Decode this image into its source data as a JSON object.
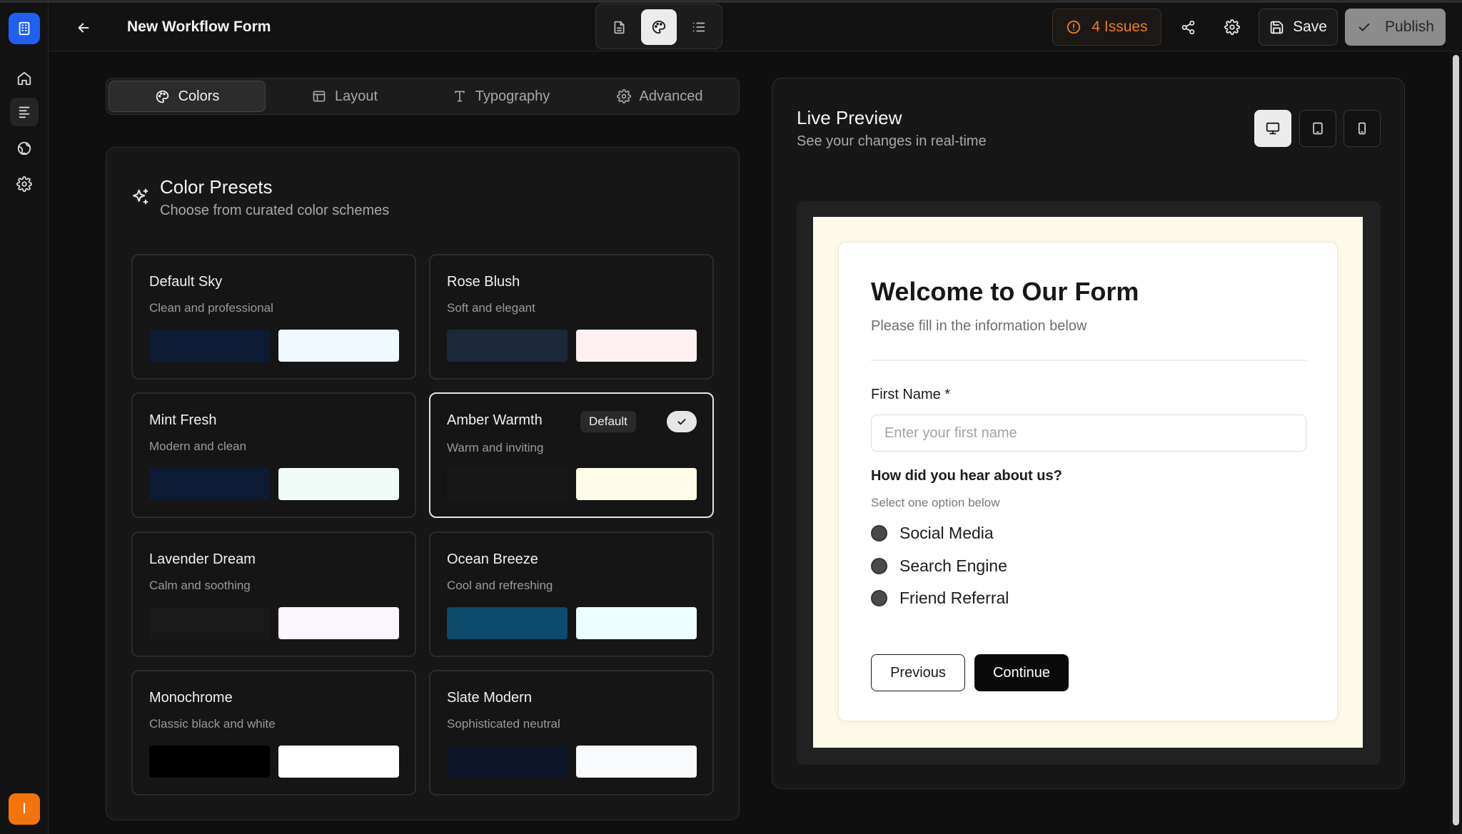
{
  "app": {
    "title": "New Workflow Form"
  },
  "rail": {
    "items": [
      {
        "name": "home",
        "icon": "home-icon"
      },
      {
        "name": "forms",
        "icon": "form-list-icon"
      },
      {
        "name": "globe",
        "icon": "globe-icon"
      },
      {
        "name": "settings",
        "icon": "gear-icon"
      }
    ],
    "active": "forms",
    "user_initial": "I",
    "logo_color": "#1f5ff2",
    "user_color": "#f4740c"
  },
  "topbar": {
    "modes": [
      "document-icon",
      "palette-icon",
      "list-icon"
    ],
    "active_mode": "palette-icon",
    "issues_label": "4 Issues",
    "issues_color": "#f07b1a",
    "save_label": "Save",
    "publish_label": "Publish"
  },
  "tabs": [
    {
      "label": "Colors",
      "icon": "palette-icon",
      "active": true
    },
    {
      "label": "Layout",
      "icon": "layout-icon",
      "active": false
    },
    {
      "label": "Typography",
      "icon": "type-icon",
      "active": false
    },
    {
      "label": "Advanced",
      "icon": "gear-icon",
      "active": false
    }
  ],
  "presets": {
    "title": "Color Presets",
    "subtitle": "Choose from curated color schemes",
    "items": [
      {
        "name": "Default Sky",
        "desc": "Clean and professional",
        "primary": "#0d1a33",
        "background": "#f0f9ff"
      },
      {
        "name": "Rose Blush",
        "desc": "Soft and elegant",
        "primary": "#1c2838",
        "background": "#fff1f2"
      },
      {
        "name": "Mint Fresh",
        "desc": "Modern and clean",
        "primary": "#0d1a33",
        "background": "#f0faf6"
      },
      {
        "name": "Amber Warmth",
        "desc": "Warm and inviting",
        "primary": "#181818",
        "background": "#fefbe8",
        "badge": "Default",
        "selected": true
      },
      {
        "name": "Lavender Dream",
        "desc": "Calm and soothing",
        "primary": "#191919",
        "background": "#faf5ff"
      },
      {
        "name": "Ocean Breeze",
        "desc": "Cool and refreshing",
        "primary": "#0c4a6e",
        "background": "#ecfeff"
      },
      {
        "name": "Monochrome",
        "desc": "Classic black and white",
        "primary": "#000000",
        "background": "#ffffff"
      },
      {
        "name": "Slate Modern",
        "desc": "Sophisticated neutral",
        "primary": "#0f172a",
        "background": "#f8fafc"
      }
    ]
  },
  "preview": {
    "title": "Live Preview",
    "subtitle": "See your changes in real-time",
    "devices": [
      "desktop-icon",
      "tablet-icon",
      "mobile-icon"
    ],
    "active_device": "desktop-icon",
    "form": {
      "title": "Welcome to Our Form",
      "subtitle": "Please fill in the information below",
      "field_label": "First Name *",
      "field_placeholder": "Enter your first name",
      "question": "How did you hear about us?",
      "hint": "Select one option below",
      "options": [
        "Social Media",
        "Search Engine",
        "Friend Referral"
      ],
      "prev_label": "Previous",
      "next_label": "Continue"
    }
  }
}
